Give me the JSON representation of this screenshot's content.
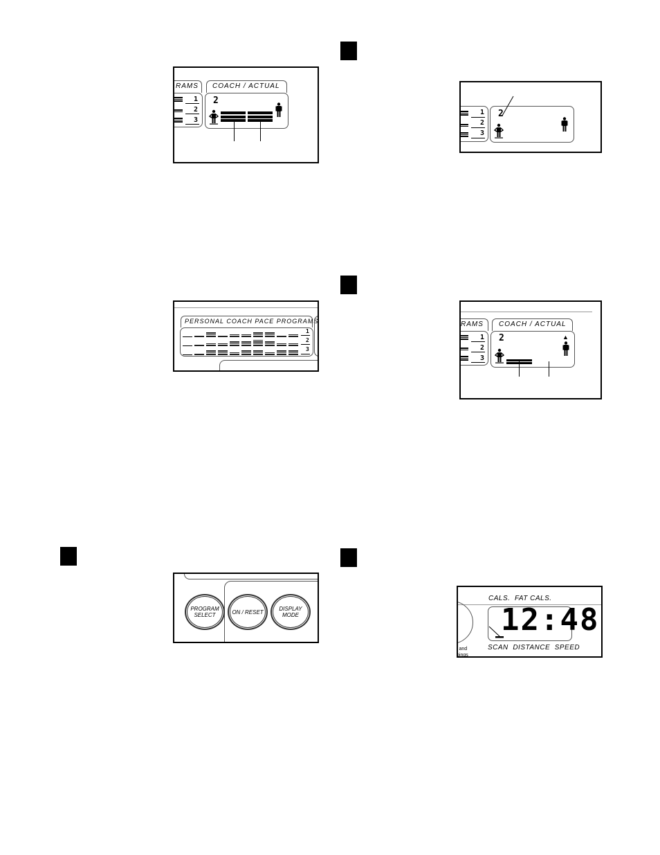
{
  "page": {
    "step_markers": [
      "step-box-1",
      "step-box-2",
      "step-box-3",
      "step-box-4",
      "step-box-5"
    ]
  },
  "figure1": {
    "programs_tab_partial": "RAMS",
    "coach_tab": "COACH / ACTUAL",
    "levels": [
      "1",
      "2",
      "3"
    ],
    "program_number": "2",
    "coach_bar_level": "full",
    "actual_bar_level": "full"
  },
  "figure2": {
    "program_number": "2",
    "levels": [
      "1",
      "2",
      "3"
    ]
  },
  "figure3": {
    "title": "PERSONAL COACH PACE PROGRAMS",
    "levels": [
      "1",
      "2",
      "3"
    ]
  },
  "figure4": {
    "programs_tab_partial": "RAMS",
    "coach_tab": "COACH / ACTUAL",
    "levels": [
      "1",
      "2",
      "3"
    ],
    "program_number": "2",
    "arrow_indicator": "▲"
  },
  "figure5": {
    "buttons": [
      {
        "line1": "PROGRAM",
        "line2": "SELECT"
      },
      {
        "line1": "ON / RESET",
        "line2": ""
      },
      {
        "line1": "DISPLAY",
        "line2": "MODE"
      }
    ]
  },
  "figure6": {
    "top_labels": "CALS.  FAT CALS.",
    "display_value": "12:48",
    "bottom_labels": "SCAN  DISTANCE  SPEED",
    "cut_text_1": "l and",
    "cut_text_2": "oings"
  }
}
